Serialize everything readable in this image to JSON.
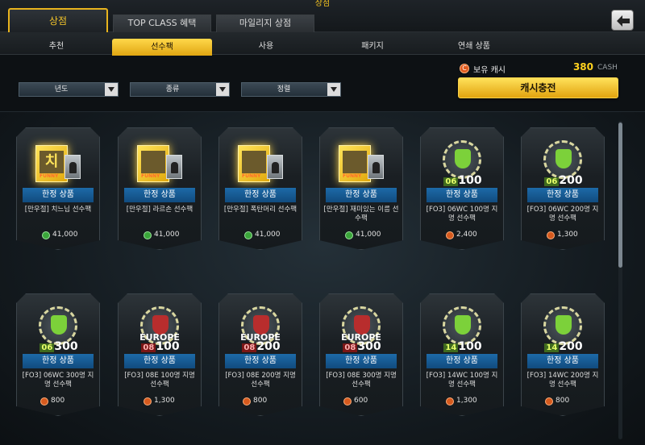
{
  "app": {
    "title": "상점"
  },
  "main_tabs": [
    {
      "label": "상점"
    },
    {
      "label": "TOP CLASS 혜택"
    },
    {
      "label": "마일리지 상점"
    }
  ],
  "sub_tabs": [
    {
      "label": "추천"
    },
    {
      "label": "선수팩"
    },
    {
      "label": "사용"
    },
    {
      "label": "패키지"
    },
    {
      "label": "연쇄 상품"
    }
  ],
  "cash": {
    "icon": "C",
    "label": "보유 캐시",
    "value": "380",
    "unit": "CASH",
    "charge_label": "캐시충전"
  },
  "filters": [
    {
      "label": "년도"
    },
    {
      "label": "종류"
    },
    {
      "label": "정렬"
    }
  ],
  "products": [
    {
      "badge": "한정 상품",
      "name": "[만우절] 치느님 선수팩",
      "price": "41,000",
      "currency": "green",
      "art": "funny-pack",
      "art_text": "치"
    },
    {
      "badge": "한정 상품",
      "name": "[만우절] 라르손 선수팩",
      "price": "41,000",
      "currency": "green",
      "art": "funny-pack",
      "art_text": ""
    },
    {
      "badge": "한정 상품",
      "name": "[만우절] 폭탄머리 선수팩",
      "price": "41,000",
      "currency": "green",
      "art": "funny-pack",
      "art_text": ""
    },
    {
      "badge": "한정 상품",
      "name": "[만우절] 재미있는 이름 선수팩",
      "price": "41,000",
      "currency": "green",
      "art": "funny-pack",
      "art_text": ""
    },
    {
      "badge": "한정 상품",
      "name": "[FO3] 06WC 100명 지명 선수팩",
      "price": "2,400",
      "currency": "orange",
      "art": "wc-medal",
      "year": "06",
      "number": "100"
    },
    {
      "badge": "한정 상품",
      "name": "[FO3] 06WC 200명 지명 선수팩",
      "price": "1,300",
      "currency": "orange",
      "art": "wc-medal",
      "year": "06",
      "number": "200"
    },
    {
      "badge": "한정 상품",
      "name": "[FO3] 06WC 300명 지명 선수팩",
      "price": "800",
      "currency": "orange",
      "art": "wc-medal",
      "year": "06",
      "number": "300"
    },
    {
      "badge": "한정 상품",
      "name": "[FO3] 08E 100명 지명 선수팩",
      "price": "1,300",
      "currency": "orange",
      "art": "euro-medal",
      "year": "08",
      "number": "100",
      "euro": "EUROPE"
    },
    {
      "badge": "한정 상품",
      "name": "[FO3] 08E 200명 지명 선수팩",
      "price": "800",
      "currency": "orange",
      "art": "euro-medal",
      "year": "08",
      "number": "200",
      "euro": "EUROPE"
    },
    {
      "badge": "한정 상품",
      "name": "[FO3] 08E 300명 지명 선수팩",
      "price": "600",
      "currency": "orange",
      "art": "euro-medal",
      "year": "08",
      "number": "300",
      "euro": "EUROPE"
    },
    {
      "badge": "한정 상품",
      "name": "[FO3] 14WC 100명 지명 선수팩",
      "price": "1,300",
      "currency": "orange",
      "art": "wc-medal",
      "year": "14",
      "number": "100"
    },
    {
      "badge": "한정 상품",
      "name": "[FO3] 14WC 200명 지명 선수팩",
      "price": "800",
      "currency": "orange",
      "art": "wc-medal",
      "year": "14",
      "number": "200"
    }
  ],
  "colors": {
    "accent": "#f3c42a",
    "badge": "#1d6aa8",
    "green_coin": "#3aa53a",
    "orange_coin": "#d65a1e"
  }
}
